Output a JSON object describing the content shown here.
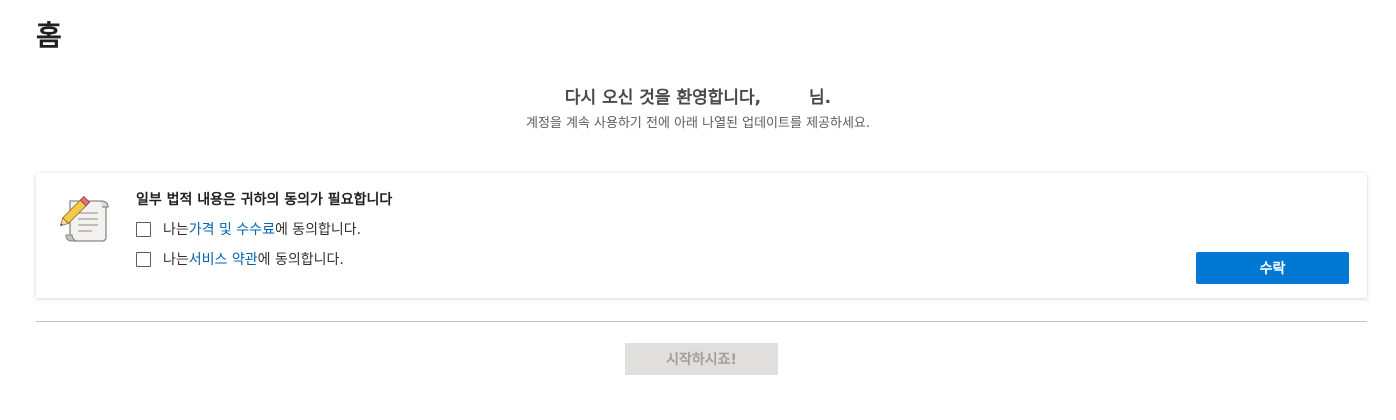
{
  "page": {
    "title": "홈"
  },
  "welcome": {
    "heading_prefix": "다시 오신 것을 환영합니다,",
    "user_name": "",
    "heading_suffix": "님.",
    "subtitle": "계정을 계속 사용하기 전에 아래 나열된 업데이트를 제공하세요."
  },
  "legal_card": {
    "icon": "document-pencil-icon",
    "heading": "일부 법적 내용은 귀하의 동의가 필요합니다",
    "items": [
      {
        "prefix": "나는 ",
        "link": "가격 및 수수료",
        "suffix": "에 동의합니다.",
        "checked": false
      },
      {
        "prefix": "나는 ",
        "link": "서비스 약관",
        "suffix": "에 동의합니다.",
        "checked": false
      }
    ],
    "accept_label": "수락"
  },
  "start_button": {
    "label": "시작하시죠!",
    "enabled": false
  },
  "colors": {
    "accent": "#0078d4",
    "link": "#0063b1",
    "disabled_bg": "#e1dfdd",
    "disabled_text": "#a19f9d"
  }
}
